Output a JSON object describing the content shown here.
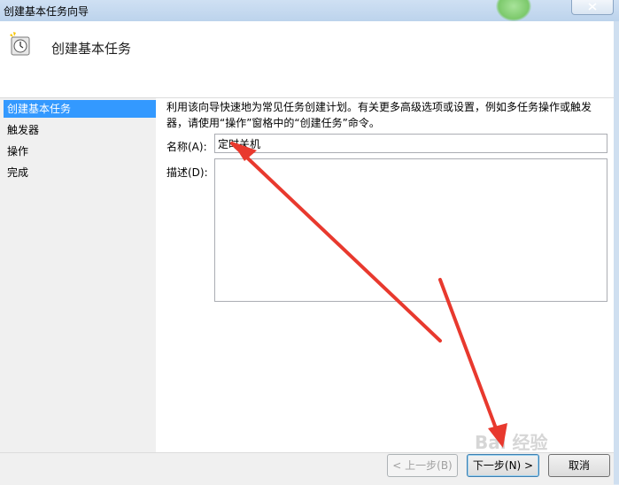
{
  "window": {
    "title": "创建基本任务向导"
  },
  "header": {
    "title": "创建基本任务",
    "icon": "clock-icon"
  },
  "sidebar": {
    "items": [
      {
        "label": "创建基本任务",
        "selected": true
      },
      {
        "label": "触发器"
      },
      {
        "label": "操作"
      },
      {
        "label": "完成"
      }
    ]
  },
  "main": {
    "description_line1": "利用该向导快速地为常见任务创建计划。有关更多高级选项或设置，例如多任务操作或触发",
    "description_line2": "器，请使用“操作”窗格中的“创建任务”命令。",
    "name_label": "名称(A):",
    "name_value": "定时关机",
    "desc_label": "描述(D):"
  },
  "footer": {
    "back_label": "< 上一步(B)",
    "next_label": "下一步(N) >",
    "cancel_label": "取消"
  },
  "watermark": {
    "text": "Bai 经验"
  },
  "colors": {
    "selection": "#3399ff",
    "annotation_arrow": "#e8392e"
  }
}
